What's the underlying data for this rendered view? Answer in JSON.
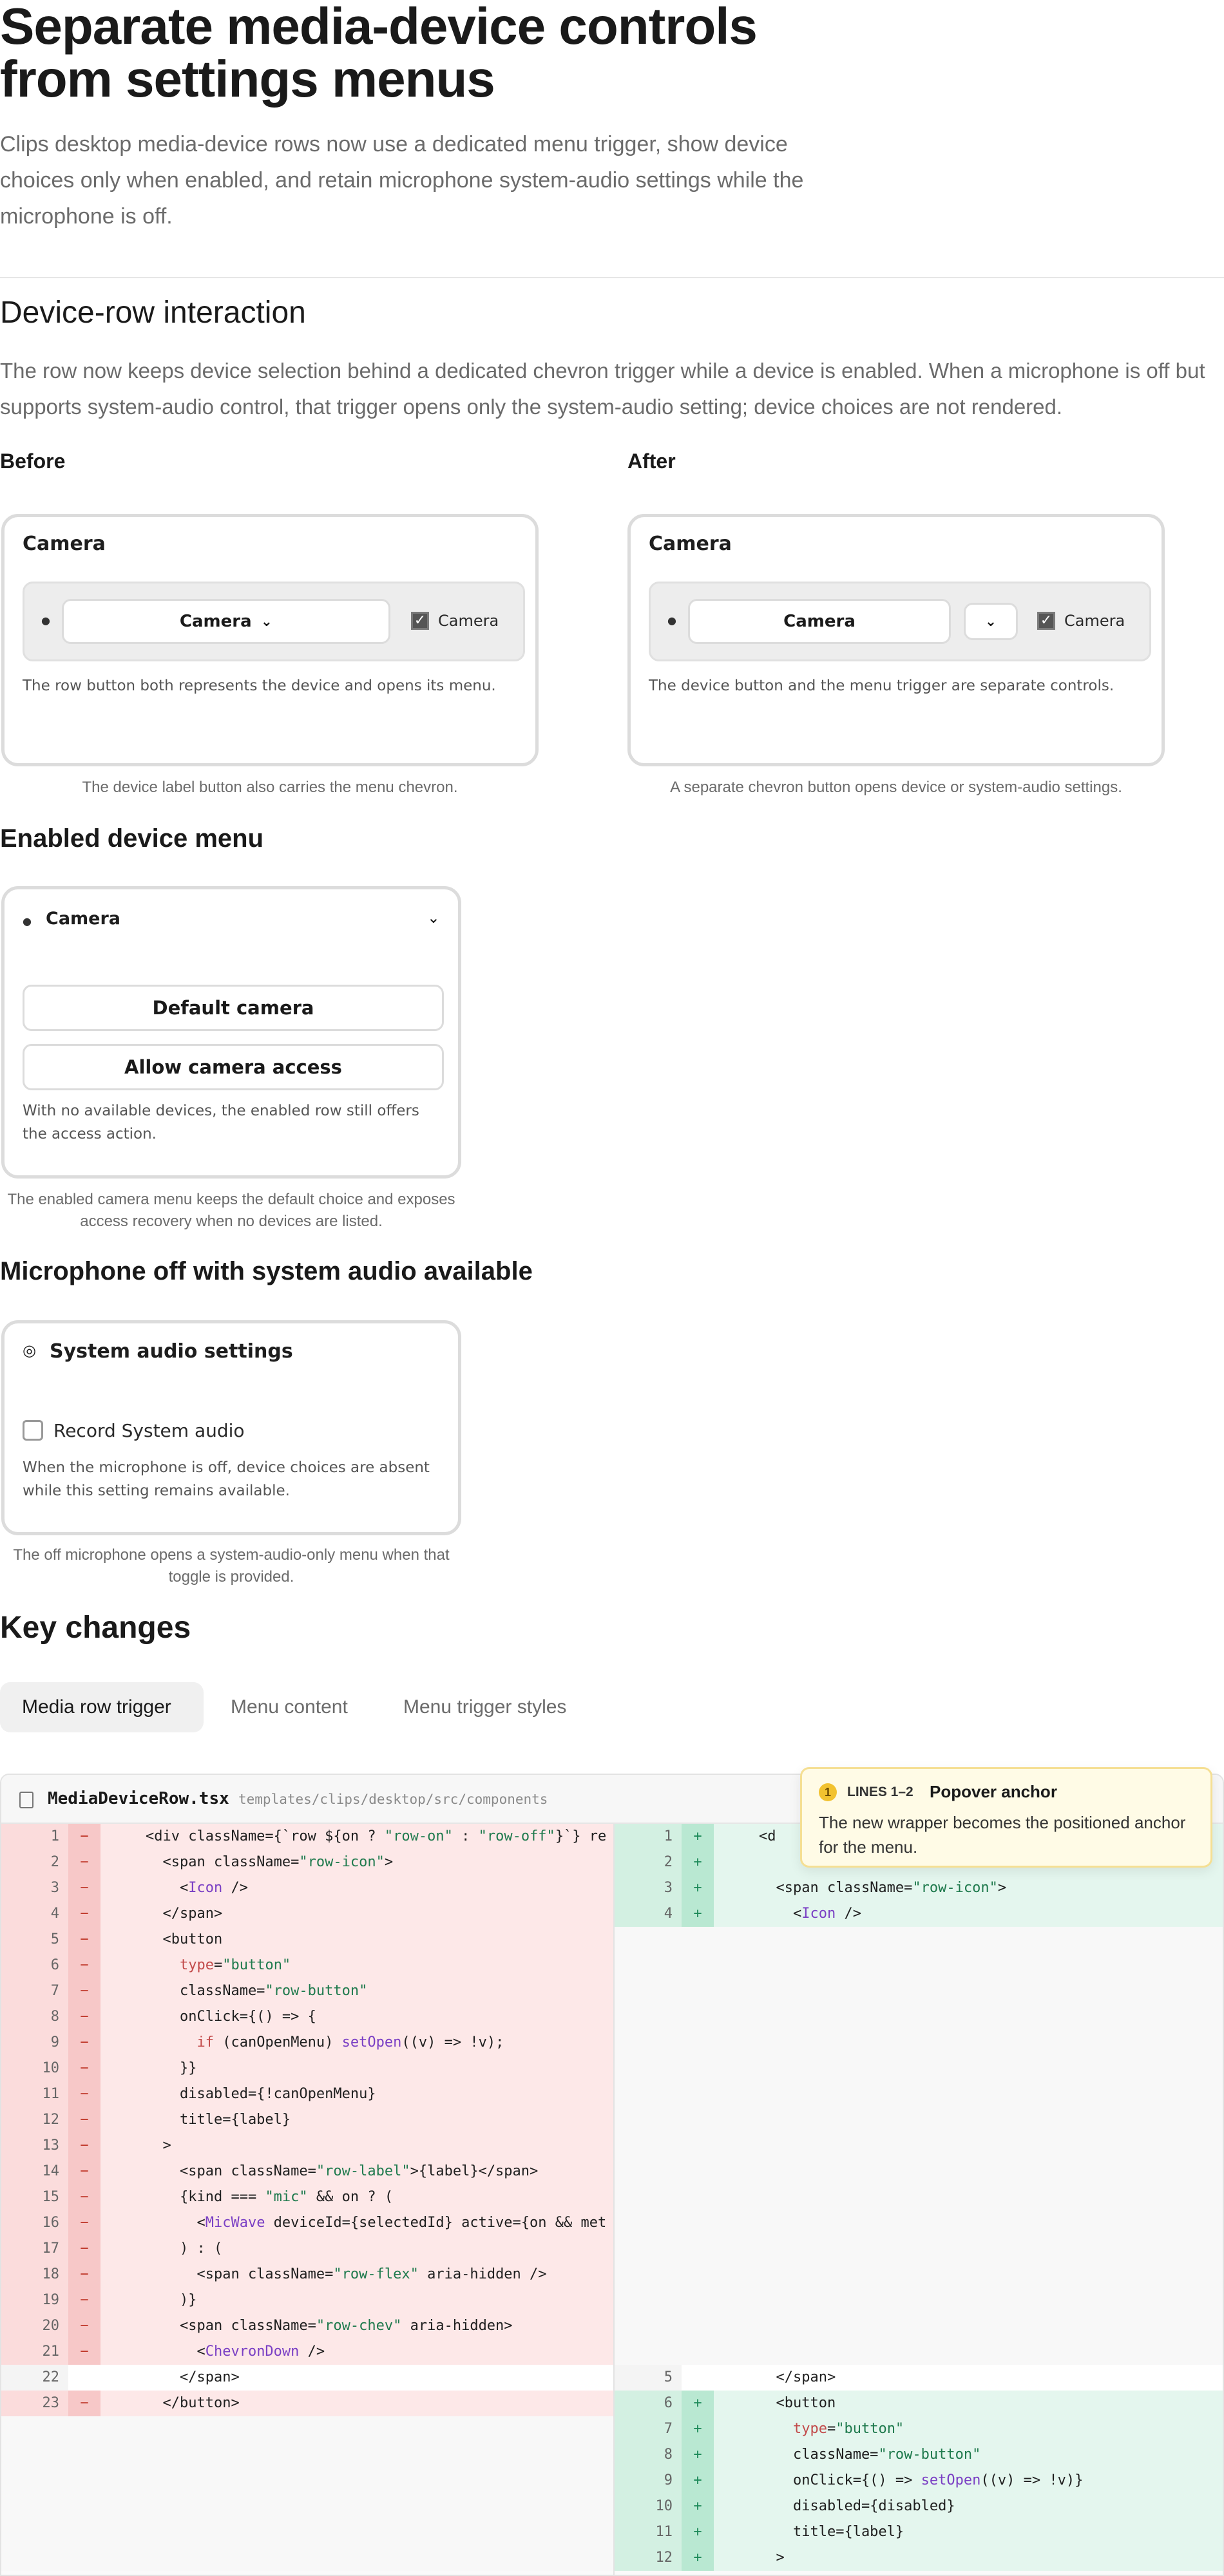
{
  "header": {
    "title": "Separate media-device controls from settings menus",
    "subtitle": "Clips desktop media-device rows now use a dedicated menu trigger, show device choices only when enabled, and retain microphone system-audio settings while the microphone is off."
  },
  "section_interaction": {
    "heading": "Device-row interaction",
    "paragraph": "The row now keeps device selection behind a dedicated chevron trigger while a device is enabled. When a microphone is off but supports system-audio control, that trigger opens only the system-audio setting; device choices are not rendered.",
    "before": {
      "label": "Before",
      "card_title": "Camera",
      "device_button": "Camera",
      "checkbox_label": "Camera",
      "note": "The row button both represents the device and opens its menu.",
      "caption": "The device label button also carries the menu chevron."
    },
    "after": {
      "label": "After",
      "card_title": "Camera",
      "device_button": "Camera",
      "checkbox_label": "Camera",
      "note": "The device button and the menu trigger are separate controls.",
      "caption": "A separate chevron button opens device or system-audio settings."
    }
  },
  "section_enabled_menu": {
    "heading": "Enabled device menu",
    "card_title": "Camera",
    "option_default": "Default camera",
    "option_access": "Allow camera access",
    "note": "With no available devices, the enabled row still offers the access action.",
    "caption": "The enabled camera menu keeps the default choice and exposes access recovery when no devices are listed."
  },
  "section_mic_off": {
    "heading": "Microphone off with system audio available",
    "card_title": "System audio settings",
    "checkbox_label": "Record System audio",
    "note": "When the microphone is off, device choices are absent while this setting remains available.",
    "caption": "The off microphone opens a system-audio-only menu when that toggle is provided."
  },
  "section_key_changes": {
    "heading": "Key changes",
    "tabs": [
      "Media row trigger",
      "Menu content",
      "Menu trigger styles"
    ],
    "active_tab": "Media row trigger"
  },
  "diff": {
    "file_name": "MediaDeviceRow.tsx",
    "file_path": "templates/clips/desktop/src/components",
    "left": [
      {
        "n": "1",
        "t": "del",
        "c": "<div className={`row ${on ? \"row-on\" : \"row-off\"}`} re"
      },
      {
        "n": "2",
        "t": "del",
        "c": "  <span className=\"row-icon\">"
      },
      {
        "n": "3",
        "t": "del",
        "c": "    <Icon />"
      },
      {
        "n": "4",
        "t": "del",
        "c": "  </span>"
      },
      {
        "n": "5",
        "t": "del",
        "c": "  <button"
      },
      {
        "n": "6",
        "t": "del",
        "c": "    type=\"button\""
      },
      {
        "n": "7",
        "t": "del",
        "c": "    className=\"row-button\""
      },
      {
        "n": "8",
        "t": "del",
        "c": "    onClick={() => {"
      },
      {
        "n": "9",
        "t": "del",
        "c": "      if (canOpenMenu) setOpen((v) => !v);"
      },
      {
        "n": "10",
        "t": "del",
        "c": "    }}"
      },
      {
        "n": "11",
        "t": "del",
        "c": "    disabled={!canOpenMenu}"
      },
      {
        "n": "12",
        "t": "del",
        "c": "    title={label}"
      },
      {
        "n": "13",
        "t": "del",
        "c": "  >"
      },
      {
        "n": "14",
        "t": "del",
        "c": "    <span className=\"row-label\">{label}</span>"
      },
      {
        "n": "15",
        "t": "del",
        "c": "    {kind === \"mic\" && on ? ("
      },
      {
        "n": "16",
        "t": "del",
        "c": "      <MicWave deviceId={selectedId} active={on && met"
      },
      {
        "n": "17",
        "t": "del",
        "c": "    ) : ("
      },
      {
        "n": "18",
        "t": "del",
        "c": "      <span className=\"row-flex\" aria-hidden />"
      },
      {
        "n": "19",
        "t": "del",
        "c": "    )}"
      },
      {
        "n": "20",
        "t": "del",
        "c": "    <span className=\"row-chev\" aria-hidden>"
      },
      {
        "n": "21",
        "t": "del",
        "c": "      <ChevronDown />"
      },
      {
        "n": "22",
        "t": "ctx",
        "c": "    </span>"
      },
      {
        "n": "23",
        "t": "del",
        "c": "  </button>"
      }
    ],
    "right": [
      {
        "n": "1",
        "t": "add",
        "c": "<d"
      },
      {
        "n": "2",
        "t": "add",
        "c": ""
      },
      {
        "n": "3",
        "t": "add",
        "c": "  <span className=\"row-icon\">"
      },
      {
        "n": "4",
        "t": "add",
        "c": "    <Icon />"
      },
      {
        "n": "5",
        "t": "ctx",
        "c": "  </span>"
      },
      {
        "n": "6",
        "t": "add",
        "c": "  <button"
      },
      {
        "n": "7",
        "t": "add",
        "c": "    type=\"button\""
      },
      {
        "n": "8",
        "t": "add",
        "c": "    className=\"row-button\""
      },
      {
        "n": "9",
        "t": "add",
        "c": "    onClick={() => setOpen((v) => !v)}"
      },
      {
        "n": "10",
        "t": "add",
        "c": "    disabled={disabled}"
      },
      {
        "n": "11",
        "t": "add",
        "c": "    title={label}"
      },
      {
        "n": "12",
        "t": "add",
        "c": "  >"
      }
    ]
  },
  "popover": {
    "badge": "1",
    "lines": "LINES 1–2",
    "title": "Popover anchor",
    "body": "The new wrapper becomes the positioned anchor for the menu."
  },
  "colors": {
    "deleted_bg": "#fde8e8",
    "added_bg": "#e4f6ee",
    "badge": "#f2c230",
    "muted_text": "#6b6b6b"
  }
}
